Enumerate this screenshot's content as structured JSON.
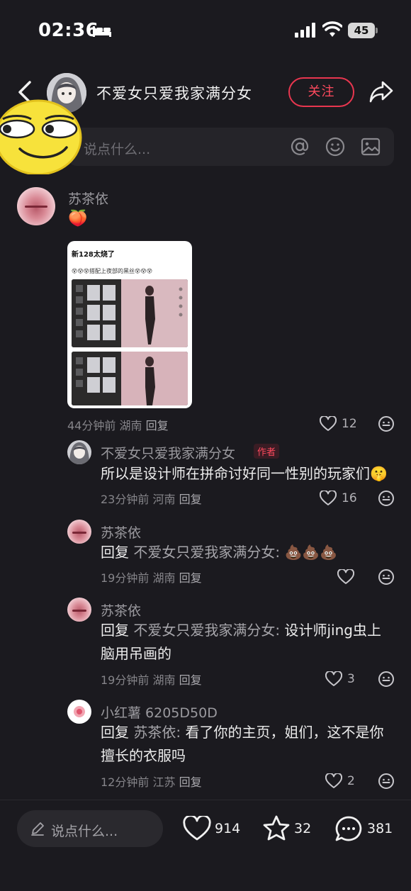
{
  "status_bar": {
    "time": "02:36",
    "battery": "45"
  },
  "header": {
    "username": "不爱女只爱我家满分女",
    "follow_label": "关注"
  },
  "top_input": {
    "placeholder": "说点什么..."
  },
  "comments": [
    {
      "username": "苏茶依",
      "emoji": "🍑",
      "image": {
        "title": "新128太烧了",
        "subtitle": "😵😵😵搭配上夜部的黑丝😵😵😵"
      },
      "meta_time": "44分钟前",
      "meta_region": "湖南",
      "reply_label": "回复",
      "likes": "12"
    }
  ],
  "replies": [
    {
      "username": "不爱女只爱我家满分女",
      "author_tag": "作者",
      "text": "所以是设计师在拼命讨好同一性别的玩家们🤫",
      "meta_time": "23分钟前",
      "meta_region": "河南",
      "reply_label": "回复",
      "likes": "16"
    },
    {
      "username": "苏茶依",
      "reply_prefix": "回复",
      "mention": "不爱女只爱我家满分女:",
      "text": "💩💩💩",
      "meta_time": "19分钟前",
      "meta_region": "湖南",
      "reply_label": "回复",
      "likes": ""
    },
    {
      "username": "苏茶依",
      "reply_prefix": "回复",
      "mention": "不爱女只爱我家满分女:",
      "text_line1": "设计师jing虫上",
      "text_line2": "脑用吊画的",
      "meta_time": "19分钟前",
      "meta_region": "湖南",
      "reply_label": "回复",
      "likes": "3"
    },
    {
      "username": "小红薯 6205D50D",
      "reply_prefix": "回复",
      "mention": "苏茶依:",
      "text_line1": "看了你的主页，姐们，这不是你",
      "text_line2": "擅长的衣服吗",
      "meta_time": "12分钟前",
      "meta_region": "江苏",
      "reply_label": "回复",
      "likes": "2"
    }
  ],
  "bottom_bar": {
    "placeholder": "说点什么...",
    "likes": "914",
    "stars": "32",
    "comments": "381"
  },
  "colors": {
    "background": "#1b1a1f",
    "accent": "#ff4a5e"
  },
  "icons": [
    "bed-icon",
    "signal-icon",
    "wifi-icon",
    "back-icon",
    "share-icon",
    "at-icon",
    "emoji-icon",
    "image-icon",
    "heart-icon",
    "reply-icon",
    "pen-icon",
    "star-icon",
    "comment-icon"
  ]
}
